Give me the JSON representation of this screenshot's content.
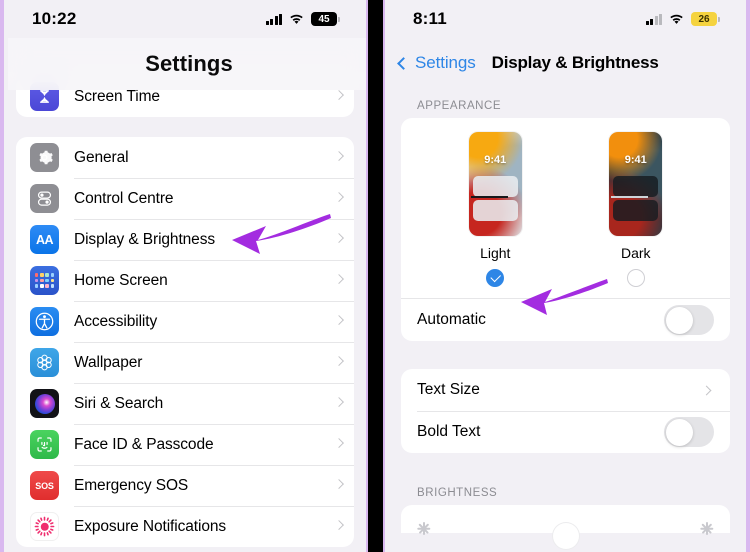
{
  "left_phone": {
    "status": {
      "time": "10:22",
      "battery": "45",
      "wifi_icon": "wifi-icon",
      "signal_icon": "cellular-bars-icon"
    },
    "nav_title": "Settings",
    "partial_top_row": {
      "label": "Screen Time",
      "icon": "hourglass-icon"
    },
    "items": [
      {
        "label": "General",
        "icon": "gear-icon"
      },
      {
        "label": "Control Centre",
        "icon": "control-centre-icon"
      },
      {
        "label": "Display & Brightness",
        "icon": "aa-icon"
      },
      {
        "label": "Home Screen",
        "icon": "home-screen-grid-icon"
      },
      {
        "label": "Accessibility",
        "icon": "accessibility-icon"
      },
      {
        "label": "Wallpaper",
        "icon": "wallpaper-flower-icon"
      },
      {
        "label": "Siri & Search",
        "icon": "siri-orb-icon"
      },
      {
        "label": "Face ID & Passcode",
        "icon": "face-id-icon"
      },
      {
        "label": "Emergency SOS",
        "icon": "sos-icon"
      },
      {
        "label": "Exposure Notifications",
        "icon": "exposure-notifications-icon"
      }
    ]
  },
  "right_phone": {
    "status": {
      "time": "8:11",
      "battery": "26",
      "battery_state": "low-power",
      "wifi_icon": "wifi-icon",
      "signal_icon": "cellular-bars-icon"
    },
    "back_label": "Settings",
    "nav_title": "Display & Brightness",
    "appearance": {
      "section_header": "APPEARANCE",
      "options": [
        {
          "name": "Light",
          "selected": true,
          "preview_clock": "9:41"
        },
        {
          "name": "Dark",
          "selected": false,
          "preview_clock": "9:41"
        }
      ],
      "automatic": {
        "label": "Automatic",
        "on": false
      }
    },
    "text_section": [
      {
        "label": "Text Size",
        "control": "chevron"
      },
      {
        "label": "Bold Text",
        "control": "toggle",
        "on": false
      }
    ],
    "brightness": {
      "section_header": "BRIGHTNESS"
    }
  },
  "annotations": {
    "color": "#a32ce0",
    "arrows": [
      {
        "name": "arrow-display-brightness",
        "target": "Display & Brightness row"
      },
      {
        "name": "arrow-light-selected",
        "target": "Light option radio"
      }
    ]
  }
}
